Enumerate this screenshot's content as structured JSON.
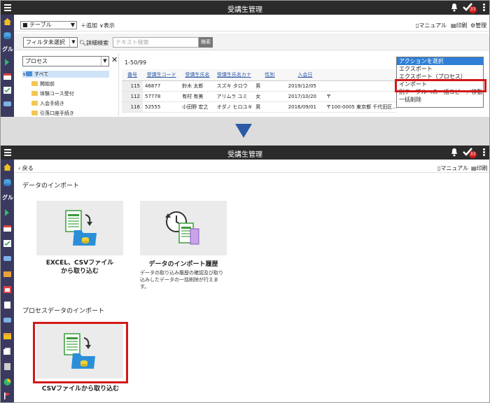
{
  "app": {
    "title": "受講生管理",
    "badge_count": "33"
  },
  "top": {
    "view_select": "■ テーブル",
    "add_label": "追加",
    "display_label": "表示",
    "manual_label": "マニュアル",
    "print_label": "印刷",
    "admin_label": "管理",
    "filter_select": "フィルタ未選択",
    "detail_search_label": "詳細検索",
    "text_search_placeholder": "テキスト検索",
    "search_button": "検索",
    "process_select": "プロセス",
    "close_glyph": "✕",
    "nav_text": "グル",
    "tree": {
      "root": "すべて",
      "items": [
        "開始前",
        "体験コース受付",
        "入会手続き",
        "引落口座手続き"
      ]
    },
    "pager": "1-50/99",
    "columns": [
      "番号",
      "受講生コード",
      "受講生氏名",
      "受講生氏名カナ",
      "性別",
      "入会日",
      ""
    ],
    "rows": [
      [
        "115",
        "46877",
        "鈴木 太郎",
        "スズキ タロウ",
        "男",
        "2019/12/05",
        ""
      ],
      [
        "112",
        "57778",
        "有村 有美",
        "アリムラ ユミ",
        "女",
        "2017/10/20",
        "〒"
      ],
      [
        "116",
        "52555",
        "小田野 宏之",
        "オダノ ヒロユキ",
        "男",
        "2016/09/01",
        "〒100-0005 東京都 千代田区..."
      ]
    ],
    "action_menu": [
      "アクションを選択",
      "エクスポート",
      "エクスポート（プロセス）",
      "インポート",
      "別テーブルへの一括コピー／移動",
      "一括削除"
    ]
  },
  "bottom": {
    "back_label": "戻る",
    "manual_label": "マニュアル",
    "print_label": "印刷",
    "nav_text": "グル",
    "section_import": "データのインポート",
    "card_excel_title": [
      "EXCEL、CSVファイル",
      "から取り込む"
    ],
    "card_history_title": "データのインポート履歴",
    "card_history_desc": [
      "データの取り込み履歴の確認及び取り",
      "込みしたデータの一括削除が行えま",
      "す。"
    ],
    "section_process_import": "プロセスデータのインポート",
    "card_csv_title": "CSVファイルから取り込む"
  },
  "colors": {
    "titlebar": "#2b2b2b",
    "nav": "#3a3a60",
    "highlight": "#d21818",
    "menu_selected": "#2f7fd6",
    "arrow": "#2b5aa6"
  }
}
